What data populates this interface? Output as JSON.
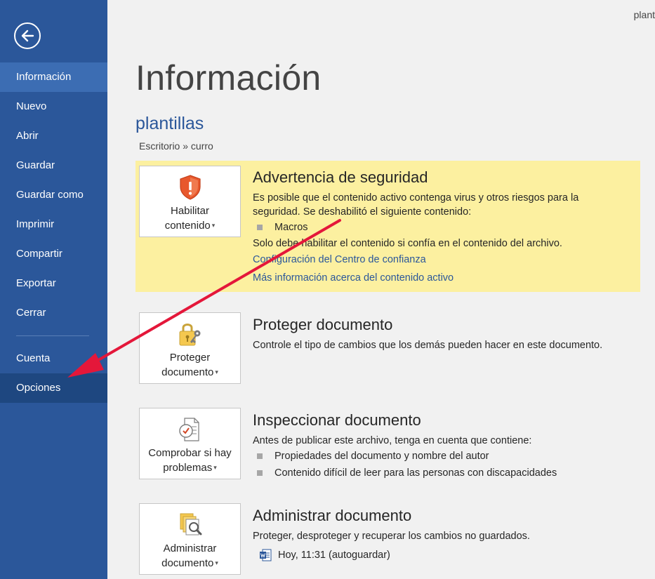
{
  "window": {
    "title_fragment": "plant"
  },
  "sidebar": {
    "items": [
      {
        "label": "Información"
      },
      {
        "label": "Nuevo"
      },
      {
        "label": "Abrir"
      },
      {
        "label": "Guardar"
      },
      {
        "label": "Guardar como"
      },
      {
        "label": "Imprimir"
      },
      {
        "label": "Compartir"
      },
      {
        "label": "Exportar"
      },
      {
        "label": "Cerrar"
      }
    ],
    "bottom_items": [
      {
        "label": "Cuenta"
      },
      {
        "label": "Opciones"
      }
    ]
  },
  "main": {
    "title": "Información",
    "doc_name": "plantillas",
    "doc_path": "Escritorio » curro",
    "security": {
      "tile_line1": "Habilitar",
      "tile_line2": "contenido",
      "title": "Advertencia de seguridad",
      "text1": "Es posible que el contenido activo contenga virus y otros riesgos para la",
      "text2": "seguridad. Se deshabilitó el siguiente contenido:",
      "bullet": "Macros",
      "text3": "Solo debe habilitar el contenido si confía en el contenido del archivo.",
      "link1": "Configuración del Centro de confianza",
      "link2": "Más información acerca del contenido activo"
    },
    "protect": {
      "tile_line1": "Proteger",
      "tile_line2": "documento",
      "title": "Proteger documento",
      "text": "Controle el tipo de cambios que los demás pueden hacer en este documento."
    },
    "inspect": {
      "tile_line1": "Comprobar si hay",
      "tile_line2": "problemas",
      "title": "Inspeccionar documento",
      "text": "Antes de publicar este archivo, tenga en cuenta que contiene:",
      "bullets": [
        "Propiedades del documento y nombre del autor",
        "Contenido difícil de leer para las personas con discapacidades"
      ]
    },
    "manage": {
      "tile_line1": "Administrar",
      "tile_line2": "documento",
      "title": "Administrar documento",
      "text": "Proteger, desproteger y recuperar los cambios no guardados.",
      "version": "Hoy, 11:31 (autoguardar)"
    }
  },
  "colors": {
    "sidebar_bg": "#2b579a",
    "warning_bg": "#fcf0a0",
    "link": "#2b579a",
    "annotation_arrow": "#e4173a"
  },
  "icons": {
    "back": "arrow-left-circle-icon",
    "security": "shield-warning-icon",
    "protect": "padlock-key-icon",
    "inspect": "document-check-icon",
    "manage": "document-search-icon",
    "version": "word-document-icon"
  }
}
